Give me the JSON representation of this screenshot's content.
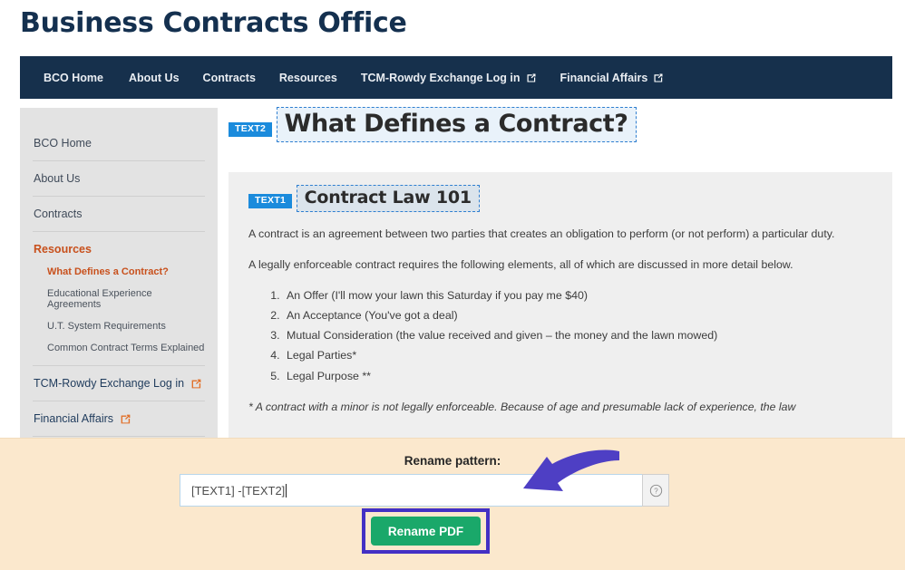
{
  "page": {
    "title": "Business Contracts Office"
  },
  "topnav": {
    "items": [
      {
        "label": "BCO Home",
        "external": false
      },
      {
        "label": "About Us",
        "external": false
      },
      {
        "label": "Contracts",
        "external": false
      },
      {
        "label": "Resources",
        "external": false
      },
      {
        "label": "TCM-Rowdy Exchange Log in",
        "external": true,
        "icon": "external-link-icon"
      },
      {
        "label": "Financial Affairs",
        "external": true,
        "icon": "external-link-icon"
      }
    ]
  },
  "sidebar": {
    "items": [
      {
        "label": "BCO Home",
        "active": false,
        "external": false
      },
      {
        "label": "About Us",
        "active": false,
        "external": false
      },
      {
        "label": "Contracts",
        "active": false,
        "external": false
      },
      {
        "label": "Resources",
        "active": true,
        "external": false
      },
      {
        "label": "TCM-Rowdy Exchange Log in",
        "active": false,
        "external": true,
        "icon": "external-link-icon"
      },
      {
        "label": "Financial Affairs",
        "active": false,
        "external": true,
        "icon": "external-link-icon"
      }
    ],
    "subitems": [
      {
        "label": "What Defines a Contract?",
        "active": true
      },
      {
        "label": "Educational Experience Agreements",
        "active": false
      },
      {
        "label": "U.T. System Requirements",
        "active": false
      },
      {
        "label": "Common Contract Terms Explained",
        "active": false
      }
    ]
  },
  "main": {
    "badge_text2": "TEXT2",
    "heading": "What Defines a Contract?",
    "badge_text1": "TEXT1",
    "subheading": "Contract Law 101",
    "paragraph1": "A contract is an agreement between two parties that creates an obligation to perform (or not perform) a particular duty.",
    "paragraph2": "A legally enforceable contract requires the following elements, all of which are discussed in more detail below.",
    "list": [
      "An Offer (I'll mow your lawn this Saturday if you pay me $40)",
      "An Acceptance (You've got a deal)",
      "Mutual Consideration (the value received and given – the money and the lawn mowed)",
      "Legal Parties*",
      "Legal Purpose **"
    ],
    "footnote": "* A contract with a minor is not legally enforceable. Because of age and presumable lack of experience, the law"
  },
  "panel": {
    "label": "Rename pattern:",
    "input_value": "[TEXT1] -[TEXT2]",
    "input_placeholder": "Enter rename pattern",
    "help_icon": "question-mark-circle-icon",
    "button_label": "Rename PDF",
    "arrow_icon": "curved-arrow-icon"
  },
  "colors": {
    "nav_bg": "#16304c",
    "title": "#14304f",
    "badge_blue": "#1b8bdc",
    "accent_orange": "#c8501c",
    "panel_bg": "#fbe8cd",
    "button_green": "#1aa86a",
    "highlight_purple": "#4330c4",
    "sidebar_bg": "#e3e3e3",
    "card_bg": "#efefef"
  }
}
